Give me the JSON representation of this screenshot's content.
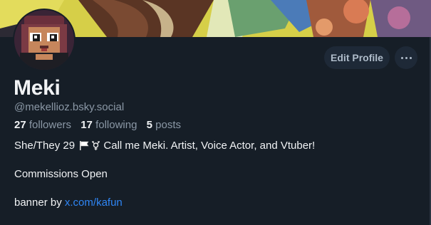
{
  "banner": {
    "icon": "banner-artwork",
    "credit_link": "x.com/kafun"
  },
  "profile": {
    "display_name": "Meki",
    "handle": "@mekellioz.bsky.social",
    "avatar": "avatar-pixel-character"
  },
  "actions": {
    "edit_label": "Edit Profile",
    "more_icon": "ellipsis-icon"
  },
  "stats": {
    "followers_count": "27",
    "followers_label": "followers",
    "following_count": "17",
    "following_label": "following",
    "posts_count": "5",
    "posts_label": "posts"
  },
  "bio": {
    "line1_prefix": "She/They 29",
    "line1_suffix": "Call me Meki. Artist, Voice Actor, and Vtuber!",
    "line1_icons": [
      "white-flag-icon",
      "transgender-symbol-icon"
    ],
    "line2": "Commissions Open",
    "line3_prefix": "banner by",
    "line3_link": "x.com/kafun"
  },
  "colors": {
    "background": "#161e27",
    "button_bg": "#1e2937",
    "link": "#2f86f5",
    "muted_text": "#8b98a6",
    "primary_text": "#f1f3f5"
  }
}
